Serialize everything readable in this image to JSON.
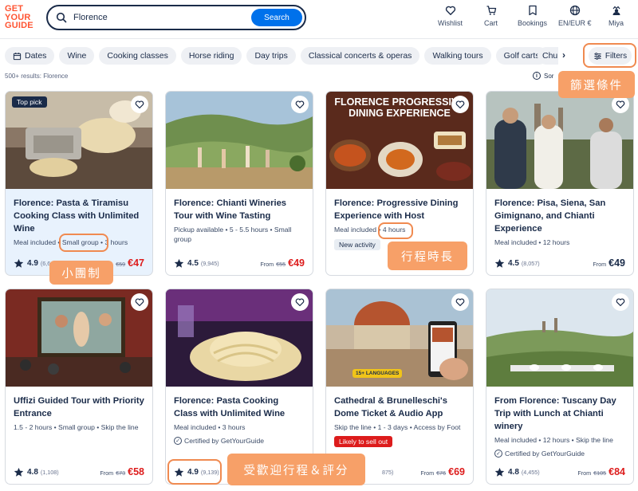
{
  "header": {
    "logo": {
      "line1": "GET",
      "line2": "YOUR",
      "line3": "GUIDE"
    },
    "search": {
      "value": "Florence",
      "button": "Search"
    },
    "nav": [
      {
        "label": "Wishlist",
        "icon": "heart-icon"
      },
      {
        "label": "Cart",
        "icon": "cart-icon"
      },
      {
        "label": "Bookings",
        "icon": "bookings-icon"
      },
      {
        "label": "EN/EUR €",
        "icon": "globe-icon"
      },
      {
        "label": "Miya",
        "icon": "profile-icon"
      }
    ]
  },
  "chips": [
    "Dates",
    "Wine",
    "Cooking classes",
    "Horse riding",
    "Day trips",
    "Classical concerts & operas",
    "Walking tours",
    "Golf carts",
    "Chu"
  ],
  "filters_label": "Filters",
  "results_text": "500+ results: Florence",
  "sort_label": "Sor",
  "cards": [
    {
      "title": "Florence: Pasta & Tiramisu Cooking Class with Unlimited Wine",
      "meta_a": "Meal included • ",
      "meta_hl": "Small group",
      "meta_b": " • 3 hours",
      "badge": "Top pick",
      "rating": "4.9",
      "count": "(6,6",
      "old": "€59",
      "price": "€47"
    },
    {
      "title": "Florence: Chianti Wineries Tour with Wine Tasting",
      "meta": "Pickup available • 5 - 5.5 hours • Small group",
      "rating": "4.5",
      "count": "(9,945)",
      "from": "From",
      "old": "€55",
      "price": "€49"
    },
    {
      "title": "Florence: Progressive Dining Experience with Host",
      "meta_a": "Meal included • ",
      "meta_hl": "4 hours",
      "tag": "New activity",
      "img_line1": "FLORENCE PROGRESSIVE",
      "img_line2": "DINING EXPERIENCE"
    },
    {
      "title": "Florence: Pisa, Siena, San Gimignano, and Chianti Experience",
      "meta": "Meal included • 12 hours",
      "rating": "4.5",
      "count": "(8,057)",
      "from": "From",
      "price": "€49"
    },
    {
      "title": "Uffizi Guided Tour with Priority Entrance",
      "meta": "1.5 - 2 hours • Small group • Skip the line",
      "rating": "4.8",
      "count": "(1,108)",
      "from": "From",
      "old": "€73",
      "price": "€58"
    },
    {
      "title": "Florence: Pasta Cooking Class with Unlimited Wine",
      "meta": "Meal included • 3 hours",
      "cert": "Certified by GetYourGuide",
      "rating": "4.9",
      "count": "(9,139)"
    },
    {
      "title": "Cathedral & Brunelleschi's Dome Ticket & Audio App",
      "meta": "Skip the line • 1 - 3 days • Access by Foot",
      "tag": "Likely to sell out",
      "img_tag": "15+ LANGUAGES",
      "count": "875)",
      "from": "From",
      "old": "€76",
      "price": "€69"
    },
    {
      "title": "From Florence: Tuscany Day Trip with Lunch at Chianti winery",
      "meta": "Meal included • 12 hours • Skip the line",
      "cert": "Certified by GetYourGuide",
      "rating": "4.8",
      "count": "(4,455)",
      "from": "From",
      "old": "€105",
      "price": "€84"
    }
  ],
  "annotations": {
    "filters": "篩選條件",
    "small_group": "小團制",
    "duration": "行程時長",
    "popular": "受歡迎行程＆評分"
  }
}
